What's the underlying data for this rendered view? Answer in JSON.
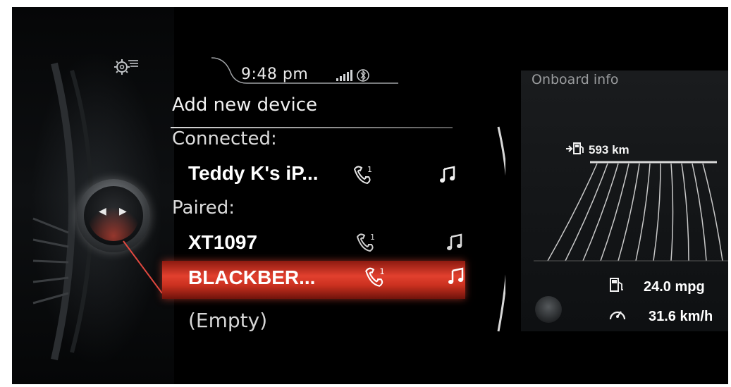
{
  "status_bar": {
    "time": "9:48 pm"
  },
  "menu": {
    "add_device_label": "Add new device",
    "connected_header": "Connected:",
    "connected_devices": [
      {
        "name": "Teddy K's iP..."
      }
    ],
    "paired_header": "Paired:",
    "paired_devices": [
      {
        "name": "XT1097"
      },
      {
        "name": "BLACKBER..."
      },
      {
        "name": "(Empty)"
      }
    ],
    "selected_index": 1,
    "icons": {
      "phone": "phone-1-icon",
      "audio": "music-note-icon"
    }
  },
  "onboard": {
    "title": "Onboard info",
    "range": "593 km",
    "fuel_economy": "24.0 mpg",
    "avg_speed": "31.6 km/h"
  },
  "colors": {
    "accent_red": "#e2402e",
    "text": "#f1f1f1",
    "background": "#000000"
  }
}
